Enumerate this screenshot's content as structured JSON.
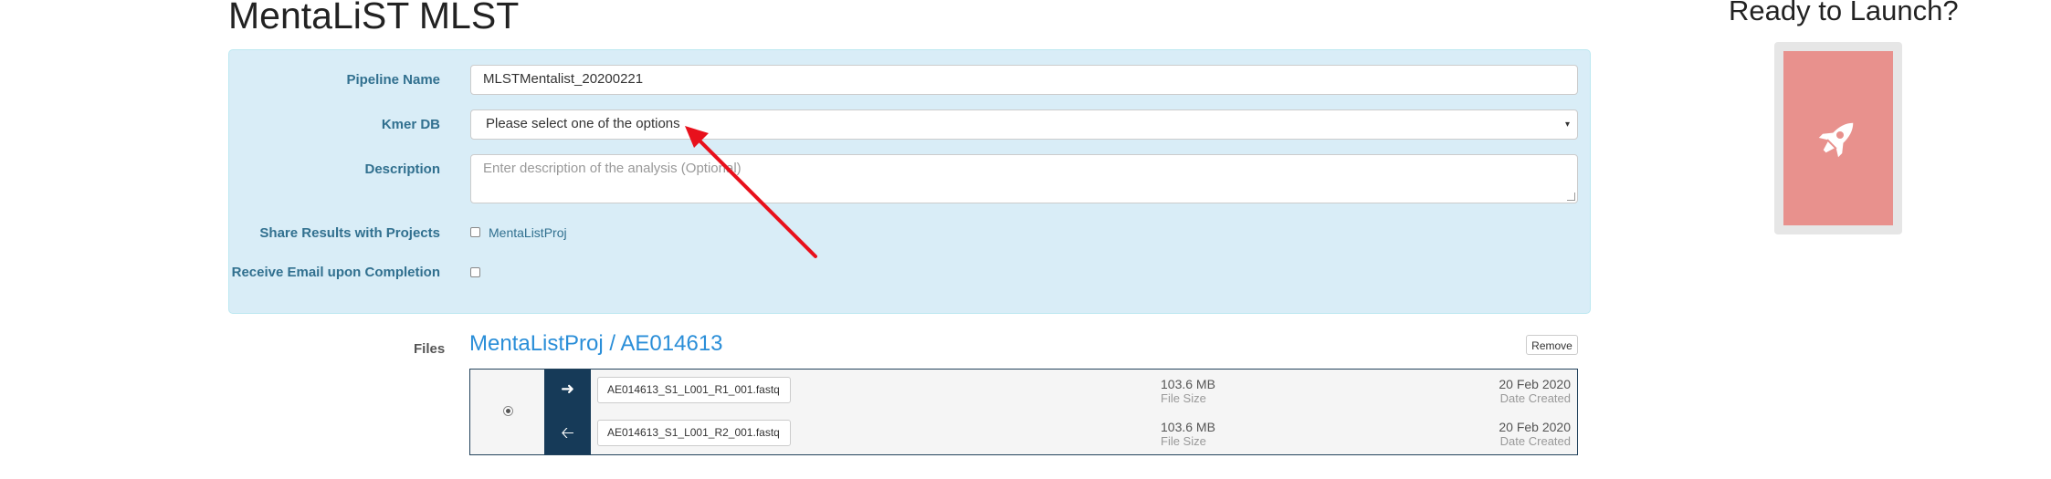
{
  "page": {
    "title": "MentaLiST MLST"
  },
  "form": {
    "pipeline_name_label": "Pipeline Name",
    "pipeline_name_value": "MLSTMentalist_20200221",
    "kmer_db_label": "Kmer DB",
    "kmer_db_value": "Please select one of the options",
    "description_label": "Description",
    "description_placeholder": "Enter description of the analysis (Optional)",
    "share_label": "Share Results with Projects",
    "share_project": "MentaListProj",
    "share_checked": false,
    "email_label": "Receive Email upon Completion",
    "email_checked": false
  },
  "files": {
    "label": "Files",
    "title": "MentaListProj / AE014613",
    "remove_label": "Remove",
    "rows": [
      {
        "direction_icon": "arrow-right-icon",
        "name": "AE014613_S1_L001_R1_001.fastq",
        "size": "103.6 MB",
        "size_label": "File Size",
        "date": "20 Feb 2020",
        "date_label": "Date Created"
      },
      {
        "direction_icon": "arrow-left-icon",
        "name": "AE014613_S1_L001_R2_001.fastq",
        "size": "103.6 MB",
        "size_label": "File Size",
        "date": "20 Feb 2020",
        "date_label": "Date Created"
      }
    ]
  },
  "launch": {
    "title": "Ready to Launch?",
    "icon": "rocket-icon"
  },
  "colors": {
    "panel_bg": "#d9edf7",
    "label_text": "#31708f",
    "link": "#2a8ed8",
    "arrow_column": "#163a58",
    "launch_button": "#e8918d",
    "annotation_arrow": "#e8111c"
  }
}
